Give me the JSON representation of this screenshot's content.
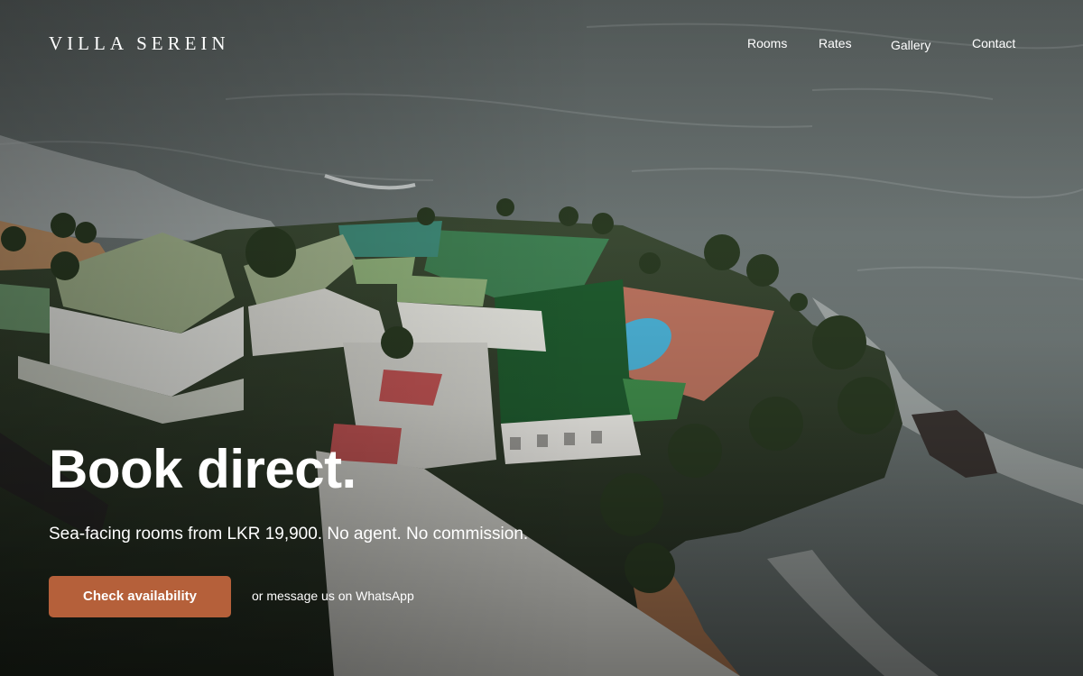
{
  "brand": {
    "name": "VILLA SEREIN"
  },
  "nav": {
    "items": [
      {
        "label": "Rooms"
      },
      {
        "label": "Rates"
      },
      {
        "label": "Gallery"
      },
      {
        "label": "Contact"
      }
    ]
  },
  "hero": {
    "headline": "Book direct.",
    "subline": "Sea-facing rooms from LKR 19,900. No agent. No commission.",
    "cta_label": "Check availability",
    "secondary_link": "or message us on WhatsApp",
    "background_image": "aerial-photo-seaside-hotel"
  },
  "colors": {
    "accent": "#b5603a",
    "text": "#ffffff"
  }
}
